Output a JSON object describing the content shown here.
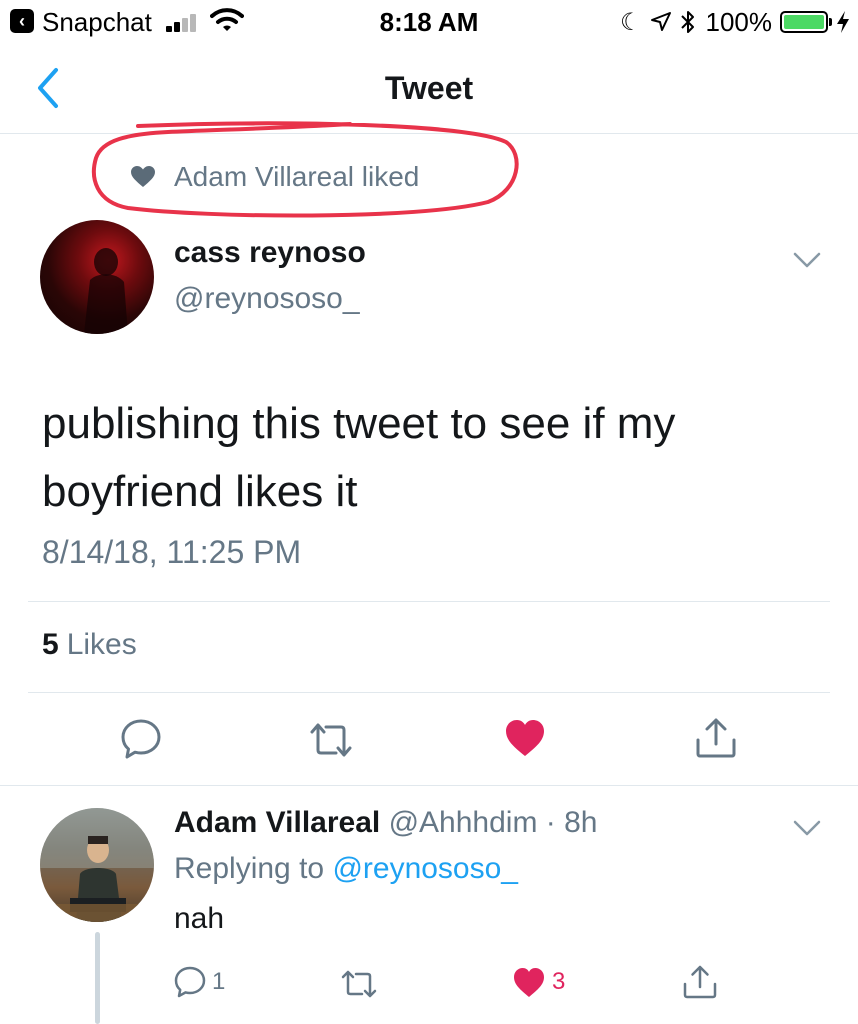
{
  "status_bar": {
    "back_app": "Snapchat",
    "time": "8:18 AM",
    "battery": "100%",
    "back_icon": "chevron-left-icon",
    "moon_icon": "do-not-disturb-icon",
    "location_icon": "location-arrow-icon",
    "bluetooth_icon": "bluetooth-icon"
  },
  "nav": {
    "title": "Tweet",
    "back_icon": "chevron-left-icon",
    "accent": "#1da1f2"
  },
  "social_context": {
    "text": "Adam Villareal liked",
    "icon": "heart-icon",
    "annotation_color": "#e8334a"
  },
  "tweet": {
    "author_name": "cass reynoso",
    "author_handle": "@reynososo_",
    "text": "publishing this tweet to see if my boyfriend likes it",
    "timestamp": "8/14/18, 11:25 PM",
    "likes_count": "5",
    "likes_label": "Likes",
    "liked": true,
    "like_color": "#e0245e"
  },
  "reply": {
    "author_name": "Adam Villareal",
    "meta": "@Ahhhdim · 8h",
    "replying_prefix": "Replying to",
    "replying_to": "@reynososo_",
    "text": "nah",
    "reply_count": "1",
    "like_count": "3",
    "liked": true
  }
}
